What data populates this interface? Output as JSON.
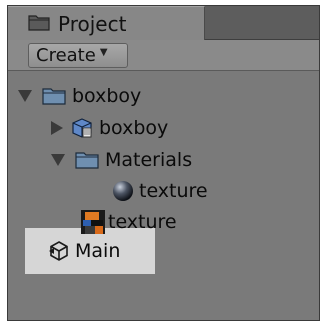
{
  "panel": {
    "tab_label": "Project"
  },
  "toolbar": {
    "create_label": "Create"
  },
  "tree": {
    "root_folder": "boxboy",
    "model": "boxboy",
    "materials_folder": "Materials",
    "material": "texture",
    "texture": "texture",
    "scene": "Main"
  },
  "colors": {
    "panel_bg": "#7a7a7a",
    "selection_bg": "#d6d6d6"
  }
}
